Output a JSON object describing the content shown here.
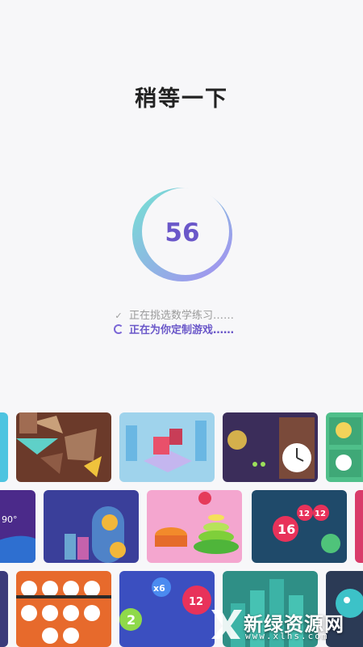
{
  "loading": {
    "title": "稍等一下",
    "progress_value": "56",
    "progress_percent": 56
  },
  "status_items": [
    {
      "text": "正在挑选数学练习……",
      "state": "done",
      "icon": "check-icon"
    },
    {
      "text": "正在为你定制游戏……",
      "state": "active",
      "icon": "spinner-icon"
    }
  ],
  "thumbnails": {
    "row2_labels": [
      "16",
      "12",
      "12"
    ],
    "row3_labels": [
      "x6",
      "2",
      "12"
    ],
    "badge_90": "90°"
  },
  "watermark": {
    "text": "新绿资源网",
    "sub": "www.xlhs.com"
  },
  "colors": {
    "accent": "#6a57c9",
    "ring_start": "#7be0d6",
    "ring_end": "#a48cf0"
  }
}
